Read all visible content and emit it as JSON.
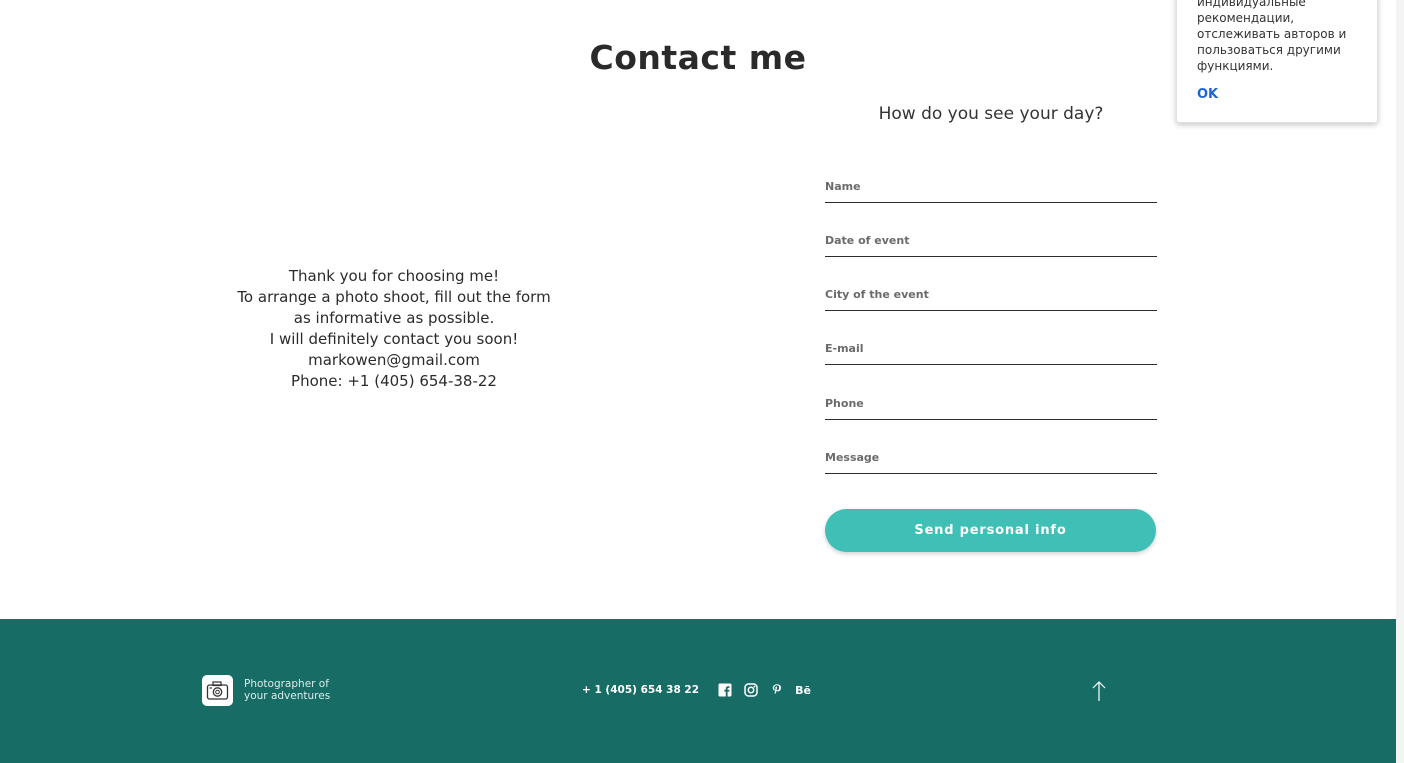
{
  "main": {
    "title": "Contact me",
    "info_lines": [
      "Thank you for choosing me!",
      "To arrange a photo shoot, fill out the form",
      "as informative as possible.",
      "I will definitely contact you soon!",
      "markowen@gmail.com",
      "Phone: +1 (405) 654-38-22"
    ]
  },
  "form": {
    "heading": "How do you see your day?",
    "fields": {
      "name": {
        "placeholder": "Name",
        "value": ""
      },
      "date": {
        "placeholder": "Date of event",
        "value": ""
      },
      "city": {
        "placeholder": "City of the event",
        "value": ""
      },
      "email": {
        "placeholder": "E-mail",
        "value": ""
      },
      "phone": {
        "placeholder": "Phone",
        "value": ""
      },
      "message": {
        "placeholder": "Message",
        "value": ""
      }
    },
    "submit_label": "Send personal info"
  },
  "footer": {
    "tagline_lines": [
      "Photographer of",
      "your adventures"
    ],
    "phone": "+ 1 (405) 654 38 22",
    "social_icons": [
      "facebook-icon",
      "instagram-icon",
      "pinterest-icon",
      "behance-icon"
    ],
    "behance_label": "Bē"
  },
  "popup": {
    "text_lines": [
      "индивидуальные",
      "рекомендации,",
      "отслеживать авторов и",
      "пользоваться другими",
      "функциями."
    ],
    "ok_label": "OK"
  },
  "colors": {
    "accent": "#3fbfb5",
    "footer_bg": "#186c66",
    "popup_link": "#1a66d2"
  }
}
